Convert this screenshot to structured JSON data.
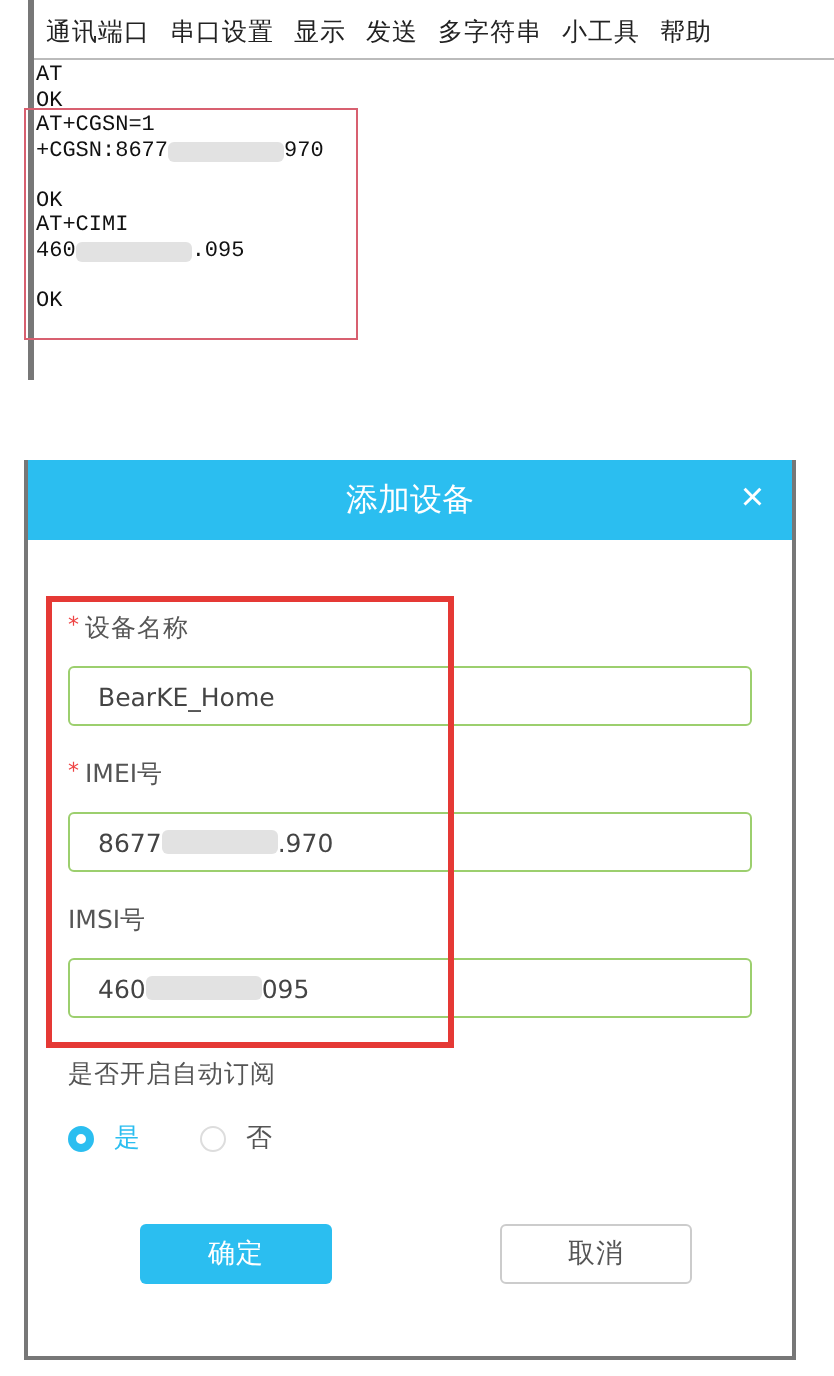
{
  "serial_tool": {
    "menu": [
      "通讯端口",
      "串口设置",
      "显示",
      "发送",
      "多字符串",
      "小工具",
      "帮助"
    ],
    "highlighted": true,
    "console_lines": [
      {
        "text": "AT",
        "spaced": false
      },
      {
        "text": "OK",
        "spaced": false
      },
      {
        "text": "AT+CGSN=1",
        "spaced": false
      },
      {
        "text": "+CGSN:8677",
        "suffix": "970",
        "redacted": true,
        "spaced": false
      },
      {
        "text": "OK",
        "spaced": true
      },
      {
        "text": "AT+CIMI",
        "spaced": false
      },
      {
        "text": "460",
        "suffix": ".095",
        "redacted": true,
        "spaced": false
      },
      {
        "text": "OK",
        "spaced": true
      }
    ]
  },
  "dialog": {
    "title": "添加设备",
    "close": "×",
    "highlighted": true,
    "fields": [
      {
        "label": "设备名称",
        "required_mark": "*",
        "value": "BearKE_Home",
        "redacted": false
      },
      {
        "label": "IMEI号",
        "required_mark": "*",
        "value": "8677",
        "suffix": ".970",
        "redacted": true
      },
      {
        "label": "IMSI号",
        "value": "460",
        "suffix": "095",
        "redacted": true
      }
    ],
    "subscribe": {
      "label": "是否开启自动订阅",
      "options": [
        {
          "label": "是",
          "selected": true
        },
        {
          "label": "否",
          "selected": false
        }
      ]
    },
    "buttons": [
      {
        "label": "确定",
        "kind": "primary"
      },
      {
        "label": "取消",
        "kind": "secondary"
      }
    ]
  }
}
